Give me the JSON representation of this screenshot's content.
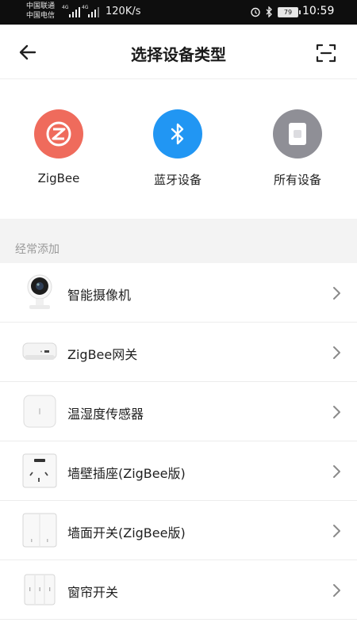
{
  "status_bar": {
    "carrier_line1": "中国联通",
    "carrier_line2": "中国电信",
    "net1": "4G",
    "net2": "4G",
    "speed": "120K/s",
    "battery": "79",
    "time": "10:59"
  },
  "header": {
    "title": "选择设备类型",
    "back_icon": "arrow-left-icon",
    "scan_icon": "scan-icon"
  },
  "categories": [
    {
      "label": "ZigBee",
      "icon": "zigbee-icon",
      "color": "#ef6b5c"
    },
    {
      "label": "蓝牙设备",
      "icon": "bluetooth-icon",
      "color": "#2196f3"
    },
    {
      "label": "所有设备",
      "icon": "all-devices-icon",
      "color": "#8f8f96"
    }
  ],
  "section": {
    "title": "经常添加"
  },
  "devices": [
    {
      "label": "智能摄像机",
      "icon": "camera-icon"
    },
    {
      "label": "ZigBee网关",
      "icon": "gateway-icon"
    },
    {
      "label": "温湿度传感器",
      "icon": "sensor-icon"
    },
    {
      "label": "墙壁插座(ZigBee版)",
      "icon": "wall-socket-icon"
    },
    {
      "label": "墙面开关(ZigBee版)",
      "icon": "wall-switch-icon"
    },
    {
      "label": "窗帘开关",
      "icon": "curtain-switch-icon"
    }
  ]
}
